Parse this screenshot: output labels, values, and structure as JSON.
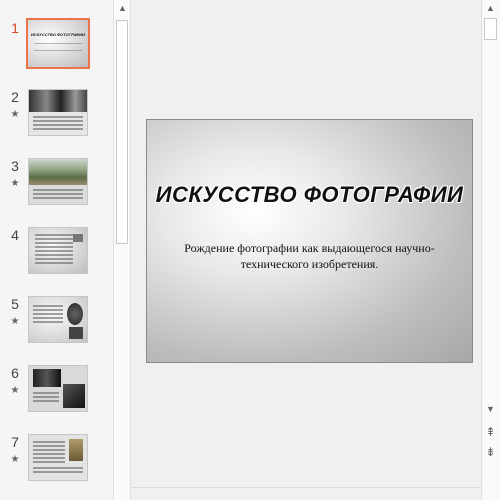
{
  "thumbnails": [
    {
      "number": "1",
      "active": true,
      "star": false,
      "title": "ИСКУССТВО ФОТОГРАФИИ"
    },
    {
      "number": "2",
      "active": false,
      "star": true
    },
    {
      "number": "3",
      "active": false,
      "star": true
    },
    {
      "number": "4",
      "active": false,
      "star": false
    },
    {
      "number": "5",
      "active": false,
      "star": true
    },
    {
      "number": "6",
      "active": false,
      "star": true
    },
    {
      "number": "7",
      "active": false,
      "star": true
    }
  ],
  "star_glyph": "★",
  "slide": {
    "title": "ИСКУССТВО ФОТОГРАФИИ",
    "subtitle": "Рождение фотографии как выдающегося научно-технического изобретения."
  },
  "scrollbars": {
    "up_glyph": "▲",
    "down_glyph": "▼",
    "prev_slide_glyph": "⇞",
    "next_slide_glyph": "⇟"
  },
  "colors": {
    "accent": "#e97548",
    "active_number": "#d24726"
  }
}
